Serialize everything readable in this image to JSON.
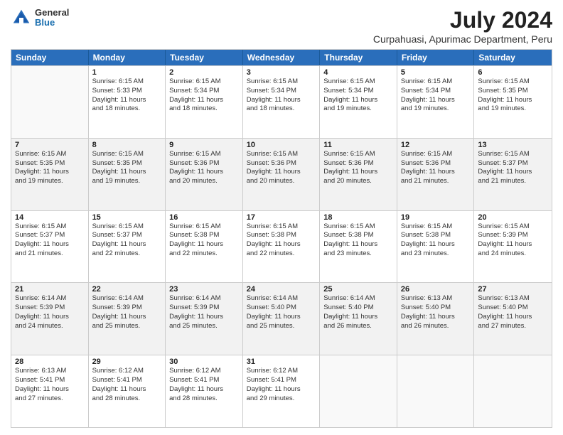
{
  "logo": {
    "general": "General",
    "blue": "Blue"
  },
  "title": {
    "month_year": "July 2024",
    "location": "Curpahuasi, Apurimac Department, Peru"
  },
  "header_days": [
    "Sunday",
    "Monday",
    "Tuesday",
    "Wednesday",
    "Thursday",
    "Friday",
    "Saturday"
  ],
  "weeks": [
    [
      {
        "day": "",
        "info": ""
      },
      {
        "day": "1",
        "info": "Sunrise: 6:15 AM\nSunset: 5:33 PM\nDaylight: 11 hours\nand 18 minutes."
      },
      {
        "day": "2",
        "info": "Sunrise: 6:15 AM\nSunset: 5:34 PM\nDaylight: 11 hours\nand 18 minutes."
      },
      {
        "day": "3",
        "info": "Sunrise: 6:15 AM\nSunset: 5:34 PM\nDaylight: 11 hours\nand 18 minutes."
      },
      {
        "day": "4",
        "info": "Sunrise: 6:15 AM\nSunset: 5:34 PM\nDaylight: 11 hours\nand 19 minutes."
      },
      {
        "day": "5",
        "info": "Sunrise: 6:15 AM\nSunset: 5:34 PM\nDaylight: 11 hours\nand 19 minutes."
      },
      {
        "day": "6",
        "info": "Sunrise: 6:15 AM\nSunset: 5:35 PM\nDaylight: 11 hours\nand 19 minutes."
      }
    ],
    [
      {
        "day": "7",
        "info": "Sunrise: 6:15 AM\nSunset: 5:35 PM\nDaylight: 11 hours\nand 19 minutes."
      },
      {
        "day": "8",
        "info": "Sunrise: 6:15 AM\nSunset: 5:35 PM\nDaylight: 11 hours\nand 19 minutes."
      },
      {
        "day": "9",
        "info": "Sunrise: 6:15 AM\nSunset: 5:36 PM\nDaylight: 11 hours\nand 20 minutes."
      },
      {
        "day": "10",
        "info": "Sunrise: 6:15 AM\nSunset: 5:36 PM\nDaylight: 11 hours\nand 20 minutes."
      },
      {
        "day": "11",
        "info": "Sunrise: 6:15 AM\nSunset: 5:36 PM\nDaylight: 11 hours\nand 20 minutes."
      },
      {
        "day": "12",
        "info": "Sunrise: 6:15 AM\nSunset: 5:36 PM\nDaylight: 11 hours\nand 21 minutes."
      },
      {
        "day": "13",
        "info": "Sunrise: 6:15 AM\nSunset: 5:37 PM\nDaylight: 11 hours\nand 21 minutes."
      }
    ],
    [
      {
        "day": "14",
        "info": "Sunrise: 6:15 AM\nSunset: 5:37 PM\nDaylight: 11 hours\nand 21 minutes."
      },
      {
        "day": "15",
        "info": "Sunrise: 6:15 AM\nSunset: 5:37 PM\nDaylight: 11 hours\nand 22 minutes."
      },
      {
        "day": "16",
        "info": "Sunrise: 6:15 AM\nSunset: 5:38 PM\nDaylight: 11 hours\nand 22 minutes."
      },
      {
        "day": "17",
        "info": "Sunrise: 6:15 AM\nSunset: 5:38 PM\nDaylight: 11 hours\nand 22 minutes."
      },
      {
        "day": "18",
        "info": "Sunrise: 6:15 AM\nSunset: 5:38 PM\nDaylight: 11 hours\nand 23 minutes."
      },
      {
        "day": "19",
        "info": "Sunrise: 6:15 AM\nSunset: 5:38 PM\nDaylight: 11 hours\nand 23 minutes."
      },
      {
        "day": "20",
        "info": "Sunrise: 6:15 AM\nSunset: 5:39 PM\nDaylight: 11 hours\nand 24 minutes."
      }
    ],
    [
      {
        "day": "21",
        "info": "Sunrise: 6:14 AM\nSunset: 5:39 PM\nDaylight: 11 hours\nand 24 minutes."
      },
      {
        "day": "22",
        "info": "Sunrise: 6:14 AM\nSunset: 5:39 PM\nDaylight: 11 hours\nand 25 minutes."
      },
      {
        "day": "23",
        "info": "Sunrise: 6:14 AM\nSunset: 5:39 PM\nDaylight: 11 hours\nand 25 minutes."
      },
      {
        "day": "24",
        "info": "Sunrise: 6:14 AM\nSunset: 5:40 PM\nDaylight: 11 hours\nand 25 minutes."
      },
      {
        "day": "25",
        "info": "Sunrise: 6:14 AM\nSunset: 5:40 PM\nDaylight: 11 hours\nand 26 minutes."
      },
      {
        "day": "26",
        "info": "Sunrise: 6:13 AM\nSunset: 5:40 PM\nDaylight: 11 hours\nand 26 minutes."
      },
      {
        "day": "27",
        "info": "Sunrise: 6:13 AM\nSunset: 5:40 PM\nDaylight: 11 hours\nand 27 minutes."
      }
    ],
    [
      {
        "day": "28",
        "info": "Sunrise: 6:13 AM\nSunset: 5:41 PM\nDaylight: 11 hours\nand 27 minutes."
      },
      {
        "day": "29",
        "info": "Sunrise: 6:12 AM\nSunset: 5:41 PM\nDaylight: 11 hours\nand 28 minutes."
      },
      {
        "day": "30",
        "info": "Sunrise: 6:12 AM\nSunset: 5:41 PM\nDaylight: 11 hours\nand 28 minutes."
      },
      {
        "day": "31",
        "info": "Sunrise: 6:12 AM\nSunset: 5:41 PM\nDaylight: 11 hours\nand 29 minutes."
      },
      {
        "day": "",
        "info": ""
      },
      {
        "day": "",
        "info": ""
      },
      {
        "day": "",
        "info": ""
      }
    ]
  ]
}
